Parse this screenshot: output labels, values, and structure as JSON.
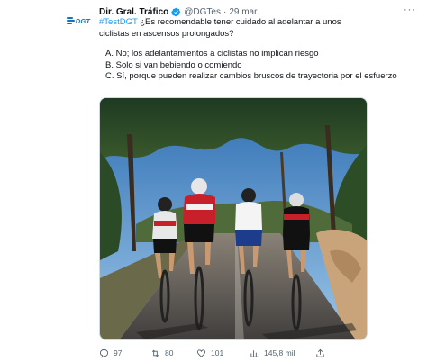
{
  "tweet": {
    "author_name": "Dir. Gral. Tráfico",
    "handle": "@DGTes",
    "separator": "·",
    "date": "29 mar.",
    "avatar_text": "DGT",
    "more_label": "···",
    "hashtag": "#TestDGT",
    "question": " ¿Es recomendable tener cuidado al adelantar a unos ciclistas en ascensos prolongados?",
    "options": [
      "A. No; los adelantamientos a ciclistas no implican riesgo",
      "B. Solo si van bebiendo o comiendo",
      "C. Sí, porque pueden realizar cambios bruscos de trayectoria por el esfuerzo"
    ]
  },
  "actions": {
    "replies": "97",
    "retweets": "80",
    "likes": "101",
    "views": "145,8 mil"
  },
  "colors": {
    "link": "#1d9bf0",
    "verified": "#1d9bf0",
    "muted": "#536471",
    "brand": "#1d6fb8"
  },
  "icons": [
    "verified-badge-icon",
    "more-icon",
    "reply-icon",
    "retweet-icon",
    "like-icon",
    "views-icon",
    "share-icon"
  ]
}
